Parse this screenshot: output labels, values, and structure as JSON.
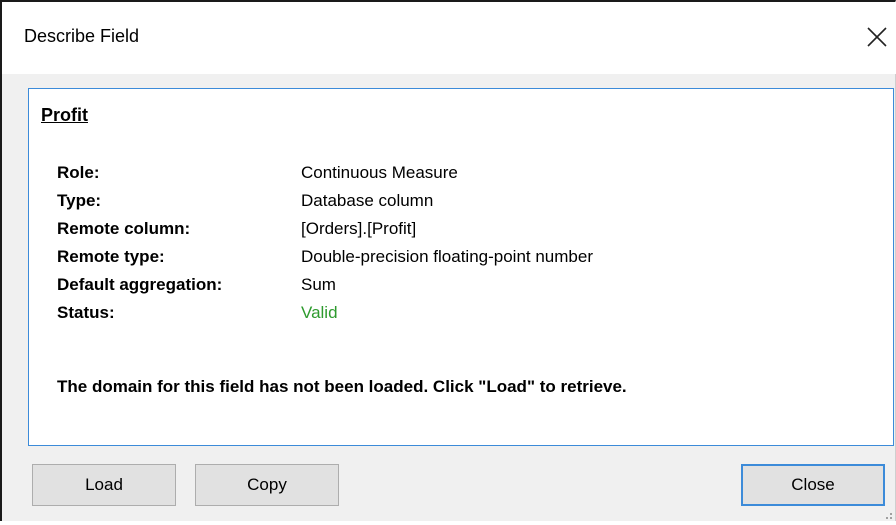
{
  "window": {
    "title": "Describe Field"
  },
  "field": {
    "name": "Profit"
  },
  "properties": [
    {
      "label": "Role:",
      "value": "Continuous Measure"
    },
    {
      "label": "Type:",
      "value": "Database column"
    },
    {
      "label": "Remote column:",
      "value": "[Orders].[Profit]"
    },
    {
      "label": "Remote type:",
      "value": "Double-precision floating-point number"
    },
    {
      "label": "Default aggregation:",
      "value": "Sum"
    },
    {
      "label": "Status:",
      "value": "Valid"
    }
  ],
  "message": "The domain for this field has not been loaded. Click \"Load\" to retrieve.",
  "buttons": {
    "load": "Load",
    "copy": "Copy",
    "close": "Close"
  },
  "colors": {
    "accent": "#3c8bd9",
    "status_valid": "#2e9b2e"
  },
  "icons": {
    "close": "close-icon",
    "resize": "resize-grip-icon"
  }
}
